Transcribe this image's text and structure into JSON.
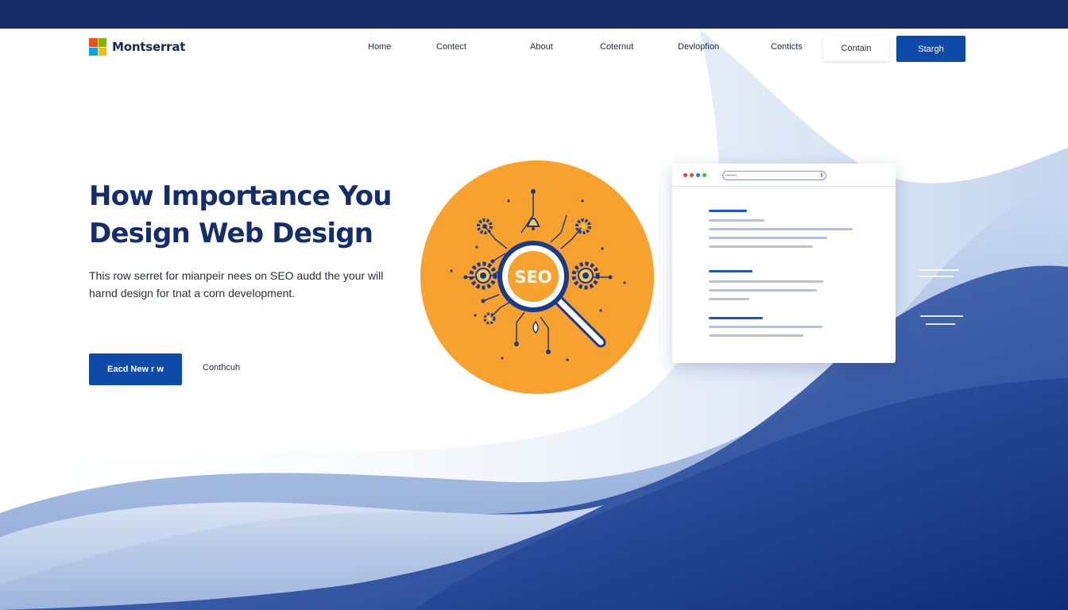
{
  "brand": {
    "name": "Montserrat",
    "logo_colors": [
      "#f25022",
      "#7fba00",
      "#00a4ef",
      "#ffb900"
    ]
  },
  "nav": {
    "links": [
      "Home",
      "Contect",
      "About",
      "Coternut",
      "Devlopfion",
      "Conticts"
    ],
    "outline_button": "Contain",
    "solid_button": "Stargh"
  },
  "hero": {
    "title_lines": [
      "How Importance You",
      "Design Web Design"
    ],
    "subtitle_lines": [
      "This row serret for mianpeir nees on SEO audd the your will",
      "harnd design for tnat a corn development."
    ],
    "primary_cta": "Eacd New r w",
    "secondary_cta": "Conthcuh"
  },
  "illustration": {
    "badge_text": "SEO",
    "icons": [
      "magnifier-icon",
      "gear-icon",
      "bell-icon"
    ]
  },
  "colors": {
    "top_bar": "#172c66",
    "primary": "#0e4aa8",
    "heading": "#142d6b",
    "orange": "#f7a22e",
    "dark_blue": "#1a3a8a"
  }
}
